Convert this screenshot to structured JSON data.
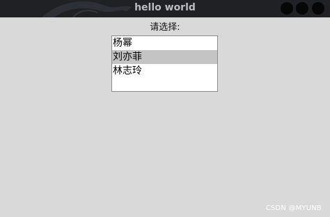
{
  "window": {
    "title": "hello world",
    "controls": [
      "close-dot",
      "minimize-dot",
      "maximize-dot"
    ]
  },
  "main": {
    "prompt": "请选择:",
    "listbox": {
      "items": [
        {
          "label": "杨幂",
          "selected": false
        },
        {
          "label": "刘亦菲",
          "selected": true
        },
        {
          "label": "林志玲",
          "selected": false
        }
      ]
    }
  },
  "watermark": "CSDN @MYUNB",
  "colors": {
    "background": "#d9d9d9",
    "titlebar": "#1f2125",
    "title_text": "#b9bcc2",
    "selection": "#c4c4c4"
  }
}
